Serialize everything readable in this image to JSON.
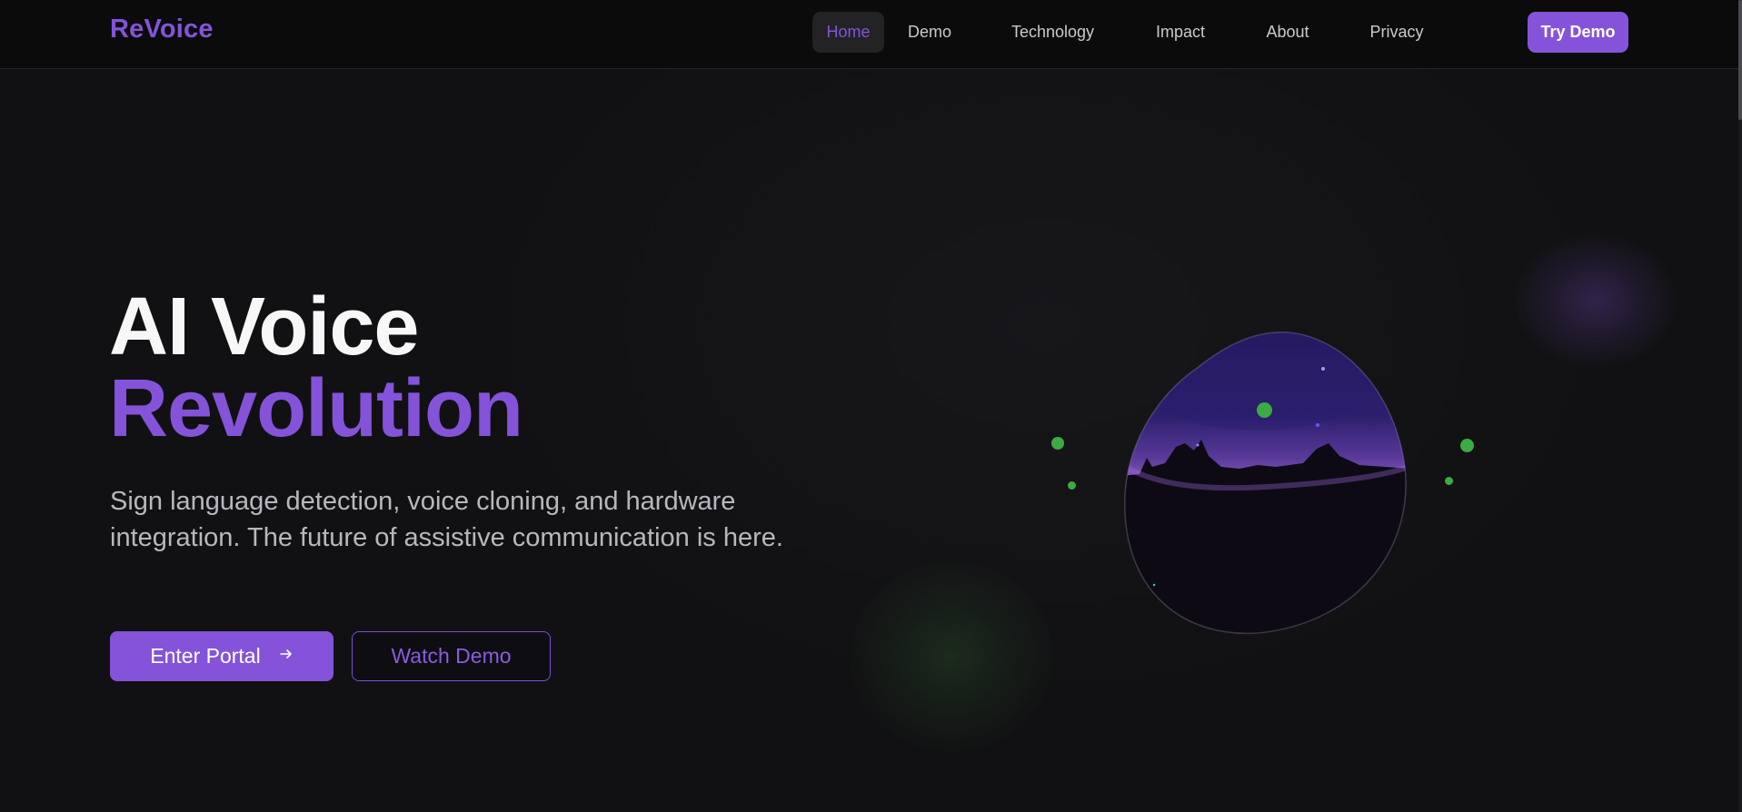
{
  "brand": {
    "name": "ReVoice",
    "accent": "#8453d9"
  },
  "nav": {
    "items": [
      {
        "label": "Home",
        "active": true
      },
      {
        "label": "Demo",
        "active": false
      },
      {
        "label": "Technology",
        "active": false
      },
      {
        "label": "Impact",
        "active": false
      },
      {
        "label": "About",
        "active": false
      },
      {
        "label": "Privacy",
        "active": false
      }
    ],
    "cta_label": "Try Demo"
  },
  "hero": {
    "title_line1": "AI Voice",
    "title_line2": "Revolution",
    "subtitle": "Sign language detection, voice cloning, and hardware integration. The future of assistive communication is here.",
    "primary_button": {
      "label": "Enter Portal",
      "icon": "arrow-right-icon"
    },
    "secondary_button": {
      "label": "Watch Demo"
    }
  },
  "colors": {
    "background": "#111113",
    "header": "#0b0b0c",
    "accent": "#8453d9",
    "particle": "#3bab42"
  }
}
